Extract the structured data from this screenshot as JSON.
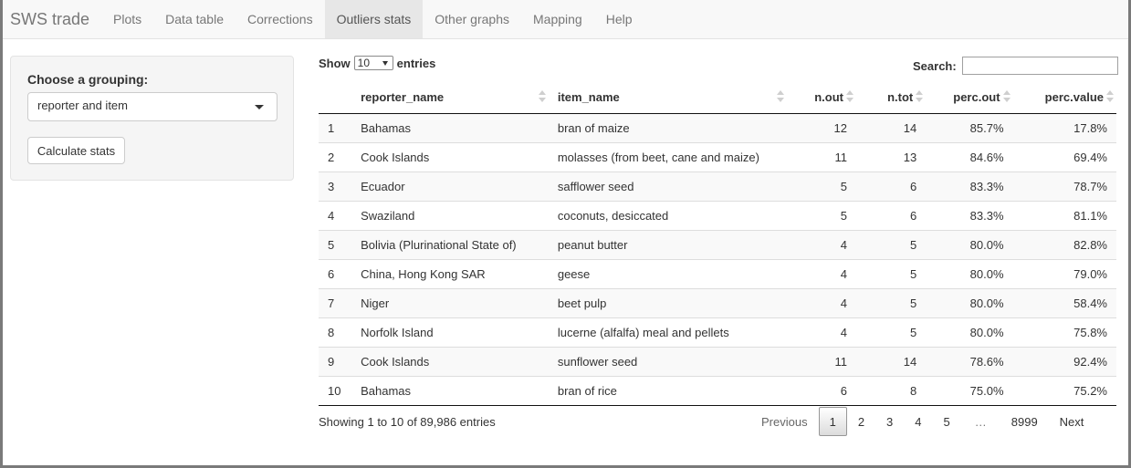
{
  "navbar": {
    "brand": "SWS trade",
    "tabs": [
      {
        "label": "Plots"
      },
      {
        "label": "Data table"
      },
      {
        "label": "Corrections"
      },
      {
        "label": "Outliers stats"
      },
      {
        "label": "Other graphs"
      },
      {
        "label": "Mapping"
      },
      {
        "label": "Help"
      }
    ],
    "active_tab": "Outliers stats"
  },
  "sidebar": {
    "grouping_label": "Choose a grouping:",
    "grouping_value": "reporter and item",
    "calc_button": "Calculate stats"
  },
  "table_controls": {
    "show_label": "Show",
    "entries_value": "10",
    "entries_label": "entries",
    "search_label": "Search:"
  },
  "table": {
    "columns": [
      "reporter_name",
      "item_name",
      "n.out",
      "n.tot",
      "perc.out",
      "perc.value"
    ],
    "rows": [
      {
        "idx": "1",
        "reporter_name": "Bahamas",
        "item_name": "bran of maize",
        "n_out": "12",
        "n_tot": "14",
        "perc_out": "85.7%",
        "perc_value": "17.8%"
      },
      {
        "idx": "2",
        "reporter_name": "Cook Islands",
        "item_name": "molasses (from beet, cane and maize)",
        "n_out": "11",
        "n_tot": "13",
        "perc_out": "84.6%",
        "perc_value": "69.4%"
      },
      {
        "idx": "3",
        "reporter_name": "Ecuador",
        "item_name": "safflower seed",
        "n_out": "5",
        "n_tot": "6",
        "perc_out": "83.3%",
        "perc_value": "78.7%"
      },
      {
        "idx": "4",
        "reporter_name": "Swaziland",
        "item_name": "coconuts, desiccated",
        "n_out": "5",
        "n_tot": "6",
        "perc_out": "83.3%",
        "perc_value": "81.1%"
      },
      {
        "idx": "5",
        "reporter_name": "Bolivia (Plurinational State of)",
        "item_name": "peanut butter",
        "n_out": "4",
        "n_tot": "5",
        "perc_out": "80.0%",
        "perc_value": "82.8%"
      },
      {
        "idx": "6",
        "reporter_name": "China, Hong Kong SAR",
        "item_name": "geese",
        "n_out": "4",
        "n_tot": "5",
        "perc_out": "80.0%",
        "perc_value": "79.0%"
      },
      {
        "idx": "7",
        "reporter_name": "Niger",
        "item_name": "beet pulp",
        "n_out": "4",
        "n_tot": "5",
        "perc_out": "80.0%",
        "perc_value": "58.4%"
      },
      {
        "idx": "8",
        "reporter_name": "Norfolk Island",
        "item_name": "lucerne (alfalfa) meal and pellets",
        "n_out": "4",
        "n_tot": "5",
        "perc_out": "80.0%",
        "perc_value": "75.8%"
      },
      {
        "idx": "9",
        "reporter_name": "Cook Islands",
        "item_name": "sunflower seed",
        "n_out": "11",
        "n_tot": "14",
        "perc_out": "78.6%",
        "perc_value": "92.4%"
      },
      {
        "idx": "10",
        "reporter_name": "Bahamas",
        "item_name": "bran of rice",
        "n_out": "6",
        "n_tot": "8",
        "perc_out": "75.0%",
        "perc_value": "75.2%"
      }
    ]
  },
  "footer": {
    "info": "Showing 1 to 10 of 89,986 entries",
    "pagination": {
      "previous": "Previous",
      "pages": [
        "1",
        "2",
        "3",
        "4",
        "5"
      ],
      "current": "1",
      "ellipsis": "…",
      "last": "8999",
      "next": "Next"
    }
  },
  "icons": {
    "sort": "sort-both-icon",
    "dropdown": "caret-down-icon"
  }
}
